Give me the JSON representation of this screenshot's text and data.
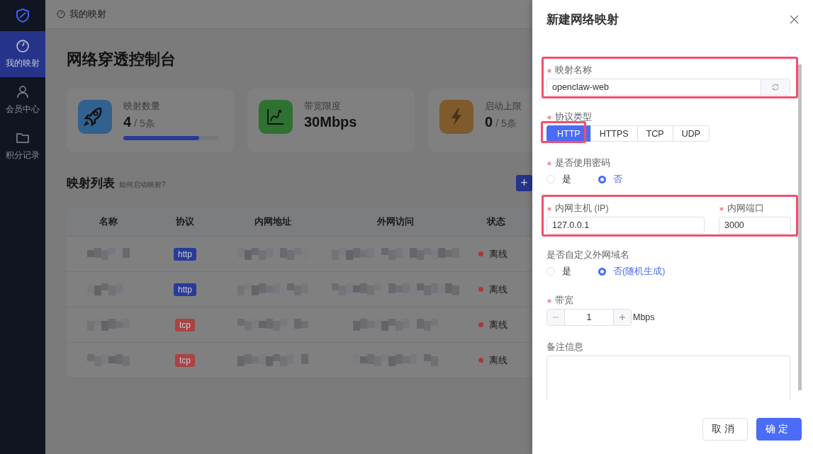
{
  "sidebar": {
    "items": [
      {
        "label": "我的映射",
        "selected": true
      },
      {
        "label": "会员中心",
        "selected": false
      },
      {
        "label": "积分记录",
        "selected": false
      }
    ]
  },
  "breadcrumb": "我的映射",
  "page_title": "网络穿透控制台",
  "stats": [
    {
      "label": "映射数量",
      "value": "4",
      "unit": "/ 5条",
      "level": 0.8,
      "color": "#31618f"
    },
    {
      "label": "带宽限度",
      "value": "30Mbps",
      "color": "#2f7131"
    },
    {
      "label": "启动上限",
      "value": "0",
      "unit": "/ 5条",
      "color": "#7e5a2d"
    }
  ],
  "list_title": "映射列表",
  "help_link": "如何启动映射?",
  "add_button": "+",
  "table": {
    "columns": [
      "名称",
      "协议",
      "内网地址",
      "外网访问",
      "状态"
    ],
    "rows": [
      {
        "protocol": {
          "label": "http",
          "color": "#2a3a96"
        },
        "status": {
          "label": "离线",
          "color": "#a83a3a"
        }
      },
      {
        "protocol": {
          "label": "http",
          "color": "#2a3a96"
        },
        "status": {
          "label": "离线",
          "color": "#a83a3a"
        }
      },
      {
        "protocol": {
          "label": "tcp",
          "color": "#a84444"
        },
        "status": {
          "label": "离线",
          "color": "#a83a3a"
        }
      },
      {
        "protocol": {
          "label": "tcp",
          "color": "#a84444"
        },
        "status": {
          "label": "离线",
          "color": "#a83a3a"
        }
      }
    ]
  },
  "drawer": {
    "title": "新建网络映射",
    "fields": [
      {
        "kind": "text_refresh",
        "label": "映射名称",
        "required": true,
        "highlighted": true,
        "value": "openclaw-web"
      },
      {
        "kind": "segmented",
        "label": "协议类型",
        "required": true,
        "highlighted": true,
        "options": [
          {
            "label": "HTTP",
            "selected": true
          },
          {
            "label": "HTTPS",
            "selected": false
          },
          {
            "label": "TCP",
            "selected": false
          },
          {
            "label": "UDP",
            "selected": false
          }
        ]
      },
      {
        "kind": "radio",
        "label": "是否使用密码",
        "required": true,
        "options": [
          {
            "label": "是",
            "selected": false
          },
          {
            "label": "否",
            "selected": true
          }
        ]
      },
      {
        "kind": "pair",
        "highlighted": true,
        "items": [
          {
            "label": "内网主机 (IP)",
            "required": true,
            "value": "127.0.0.1"
          },
          {
            "label": "内网端口",
            "required": true,
            "value": "3000"
          }
        ]
      },
      {
        "kind": "radio",
        "label": "是否自定义外网域名",
        "required": false,
        "options": [
          {
            "label": "是",
            "selected": false
          },
          {
            "label": "否(随机生成)",
            "selected": true
          }
        ]
      },
      {
        "kind": "stepper",
        "label": "带宽",
        "required": true,
        "value": "1",
        "unit": "Mbps"
      },
      {
        "kind": "textarea",
        "label": "备注信息",
        "required": false
      }
    ],
    "buttons": [
      {
        "label": "取消",
        "kind": "secondary"
      },
      {
        "label": "确定",
        "kind": "primary"
      }
    ]
  }
}
